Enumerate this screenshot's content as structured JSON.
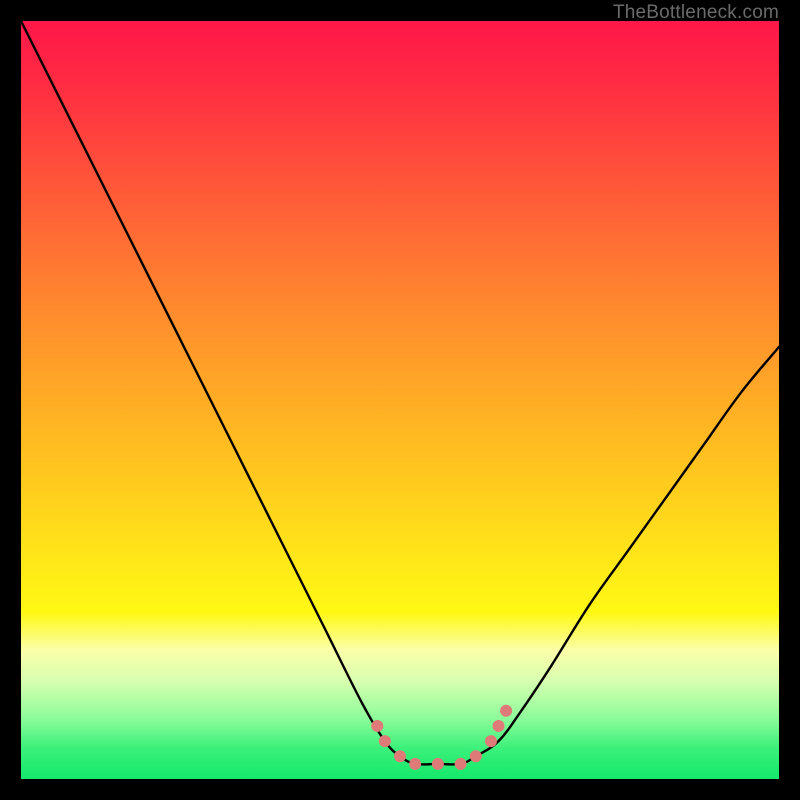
{
  "attribution": "TheBottleneck.com",
  "colors": {
    "frame": "#000000",
    "gradient_top": "#ff1749",
    "gradient_bottom": "#14e96b",
    "curve": "#000000",
    "markers": "#de7a77"
  },
  "chart_data": {
    "type": "line",
    "title": "",
    "xlabel": "",
    "ylabel": "",
    "xlim": [
      0,
      100
    ],
    "ylim": [
      0,
      100
    ],
    "grid": false,
    "legend": false,
    "note": "Unlabeled bottleneck-style curve on a vertical heat gradient. Values below are visual estimates read off the plot (origin bottom-left, both axes 0–100).",
    "series": [
      {
        "name": "curve-left",
        "x": [
          0,
          5,
          10,
          15,
          20,
          25,
          30,
          35,
          40,
          45,
          48,
          50,
          52,
          55
        ],
        "y": [
          100,
          90,
          80,
          70,
          60,
          50,
          40,
          30,
          20,
          10,
          5,
          3,
          2,
          2
        ]
      },
      {
        "name": "curve-right",
        "x": [
          55,
          58,
          60,
          63,
          66,
          70,
          75,
          80,
          85,
          90,
          95,
          100
        ],
        "y": [
          2,
          2,
          3,
          5,
          9,
          15,
          23,
          30,
          37,
          44,
          51,
          57
        ]
      }
    ],
    "markers": {
      "name": "highlight-dots",
      "points": [
        {
          "x": 47,
          "y": 7
        },
        {
          "x": 48,
          "y": 5
        },
        {
          "x": 50,
          "y": 3
        },
        {
          "x": 52,
          "y": 2
        },
        {
          "x": 55,
          "y": 2
        },
        {
          "x": 58,
          "y": 2
        },
        {
          "x": 60,
          "y": 3
        },
        {
          "x": 62,
          "y": 5
        },
        {
          "x": 63,
          "y": 7
        },
        {
          "x": 64,
          "y": 9
        }
      ],
      "radius": 6
    }
  }
}
